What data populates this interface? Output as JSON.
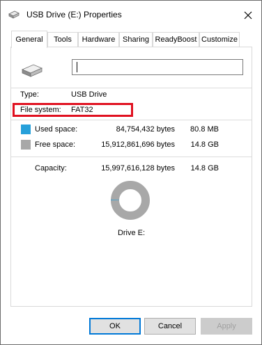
{
  "window": {
    "title": "USB Drive (E:) Properties"
  },
  "tabs": [
    {
      "label": "General",
      "active": true
    },
    {
      "label": "Tools"
    },
    {
      "label": "Hardware"
    },
    {
      "label": "Sharing"
    },
    {
      "label": "ReadyBoost"
    },
    {
      "label": "Customize"
    }
  ],
  "general": {
    "volume_name_value": "",
    "type_label": "Type:",
    "type_value": "USB Drive",
    "filesystem_label": "File system:",
    "filesystem_value": "FAT32",
    "used": {
      "label": "Used space:",
      "bytes": "84,754,432 bytes",
      "size": "80.8 MB",
      "color": "#26a0da",
      "fraction": 0.0053
    },
    "free": {
      "label": "Free space:",
      "bytes": "15,912,861,696 bytes",
      "size": "14.8 GB",
      "color": "#a8a8a8"
    },
    "capacity": {
      "label": "Capacity:",
      "bytes": "15,997,616,128 bytes",
      "size": "14.8 GB"
    },
    "drive_label": "Drive E:"
  },
  "buttons": {
    "ok": "OK",
    "cancel": "Cancel",
    "apply": "Apply"
  },
  "colors": {
    "highlight": "#e0101f",
    "accent": "#0078d7"
  }
}
